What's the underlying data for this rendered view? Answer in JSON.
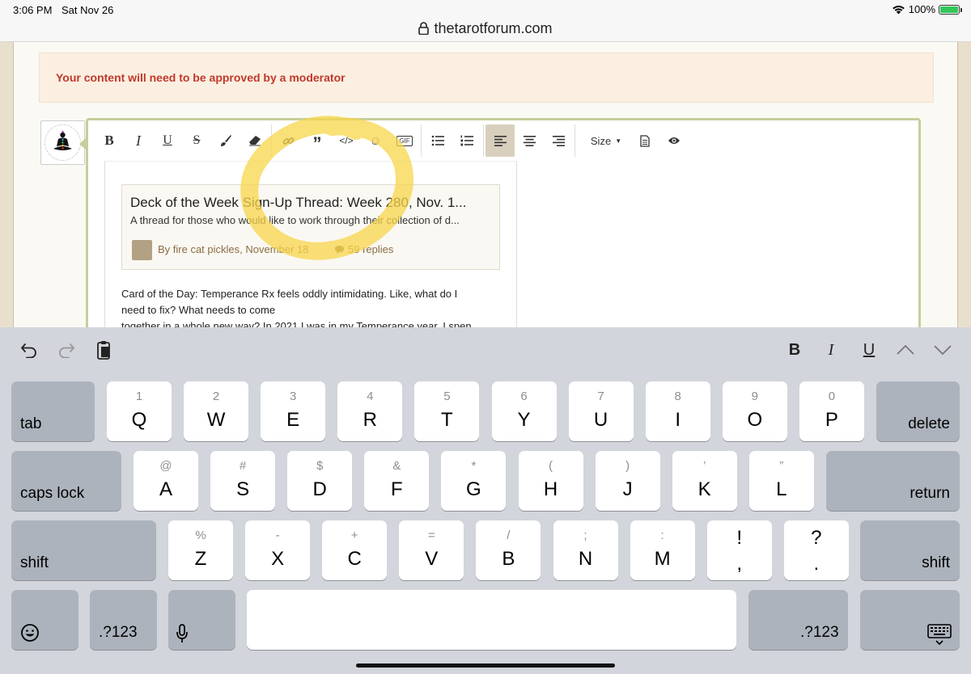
{
  "status": {
    "time": "3:06 PM",
    "date": "Sat Nov 26",
    "battery": "100%",
    "battery_level": 1.0
  },
  "url": "thetarotforum.com",
  "notice": "Your content will need to be approved by a moderator",
  "toolbar": {
    "buttons": [
      "bold-icon",
      "italic-icon",
      "underline-icon",
      "strikethrough-icon",
      "brush-icon",
      "eraser-icon",
      "link-icon",
      "quote-icon",
      "code-icon",
      "emoji-icon",
      "gif-icon",
      "bullet-list-icon",
      "numbered-list-icon",
      "align-left-icon",
      "align-center-icon",
      "align-right-icon",
      "size-dropdown",
      "template-icon",
      "preview-icon"
    ],
    "size_label": "Size",
    "gif_label": "GIF"
  },
  "embed": {
    "title": "Deck of the Week Sign-Up Thread: Week 280, Nov. 1...",
    "description": "A thread for those who would like to work through their collection of d...",
    "meta": "By fire cat pickles, November 18",
    "replies": "59 replies"
  },
  "body_text": {
    "line1": "Card of the Day:   Temperance Rx feels oddly intimidating. Like, what do I",
    "line2": "need to fix? What needs to come",
    "line3": "together in a whole new way? In 2021 I was in my Temperance year. I spen..."
  },
  "keyboard": {
    "bar": {
      "bold": "B",
      "italic": "I",
      "underline": "U"
    },
    "row1": [
      {
        "k": "Q",
        "s": "1"
      },
      {
        "k": "W",
        "s": "2"
      },
      {
        "k": "E",
        "s": "3"
      },
      {
        "k": "R",
        "s": "4"
      },
      {
        "k": "T",
        "s": "5"
      },
      {
        "k": "Y",
        "s": "6"
      },
      {
        "k": "U",
        "s": "7"
      },
      {
        "k": "I",
        "s": "8"
      },
      {
        "k": "O",
        "s": "9"
      },
      {
        "k": "P",
        "s": "0"
      }
    ],
    "row2": [
      {
        "k": "A",
        "s": "@"
      },
      {
        "k": "S",
        "s": "#"
      },
      {
        "k": "D",
        "s": "$"
      },
      {
        "k": "F",
        "s": "&"
      },
      {
        "k": "G",
        "s": "*"
      },
      {
        "k": "H",
        "s": "("
      },
      {
        "k": "J",
        "s": ")"
      },
      {
        "k": "K",
        "s": "’"
      },
      {
        "k": "L",
        "s": "”"
      }
    ],
    "row3": [
      {
        "k": "Z",
        "s": "%"
      },
      {
        "k": "X",
        "s": "-"
      },
      {
        "k": "C",
        "s": "+"
      },
      {
        "k": "V",
        "s": "="
      },
      {
        "k": "B",
        "s": "/"
      },
      {
        "k": "N",
        "s": ";"
      },
      {
        "k": "M",
        "s": ":"
      },
      {
        "k": ",",
        "s": "!"
      },
      {
        "k": ".",
        "s": "?"
      }
    ],
    "tab": "tab",
    "delete": "delete",
    "caps_lock": "caps lock",
    "return": "return",
    "shift": "shift",
    "numbers": ".?123"
  }
}
